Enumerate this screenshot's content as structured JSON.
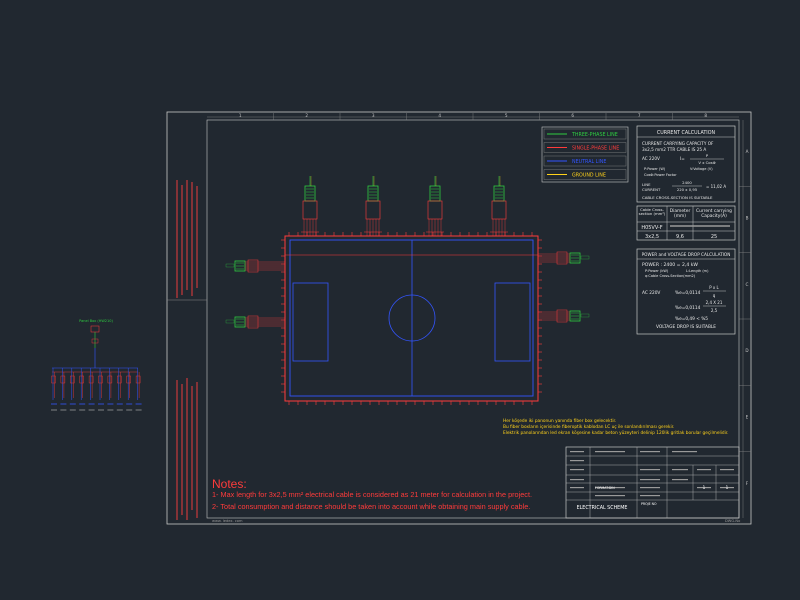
{
  "legend": {
    "items": [
      {
        "label": "THREE-PHASE LINE",
        "color": "#2ecc40"
      },
      {
        "label": "SINGLE-PHASE LINE",
        "color": "#ff3b3b"
      },
      {
        "label": "NEUTRAL LINE",
        "color": "#3355ff"
      },
      {
        "label": "GROUND LINE",
        "color": "#ffd21a"
      }
    ]
  },
  "column_numbers": [
    "1",
    "2",
    "3",
    "4",
    "5",
    "6",
    "7",
    "8"
  ],
  "row_letters": [
    "A",
    "B",
    "C",
    "D",
    "E",
    "F"
  ],
  "current_calc": {
    "title": "CURRENT CALCULATION",
    "line1": "CURRENT CARRYING CAPACITY OF",
    "line2": "3x2,5 mm2 TTR CABLE IS 25 A",
    "ac": "AC 220V",
    "i_eq": "I=",
    "frac_top": "P",
    "frac_bot": "V x CosΦ",
    "p_def": "P:Power (W)",
    "v_def": "V:Voltage (V)",
    "cos_def": "CosΦ:Power Factor",
    "line_current_a": "LINE",
    "line_current_b": "CURRENT",
    "lc_top": "2400",
    "lc_bot": "220 x 0,95",
    "lc_result": "= 11,02 A",
    "cable_ok": "CABLE CROSS-SECTION IS SUITABLE"
  },
  "cable_table": {
    "headers": [
      "Cable Cross-section (mm²)",
      "Diameter (mm)",
      "Current carrying Capacity(A)"
    ],
    "row1": [
      "H05VV-F",
      "",
      ""
    ],
    "row2": [
      "3x2,5",
      "9,6",
      "25"
    ]
  },
  "voltage_calc": {
    "title": "POWER and VOLTAGE DROP CALCULATION",
    "power": "POWER : 2400 = 2,4 kW",
    "p_def": "P:Power (kW)",
    "l_def": "L:Length (m)",
    "s_def": "q:Cable Cross-Section(mm2)",
    "ac": "AC 220V",
    "eq1": "%e=0,0114",
    "f1_top": "P x L",
    "f1_bot": "q",
    "eq2": "%e=0,0114",
    "f2_top": "2,4 X 21",
    "f2_bot": "2,5",
    "eq3": "%e=0,49 < %5",
    "ok": "VOLTAGE DROP IS SUITABLE"
  },
  "turkish_notes": [
    "Her köşede iki panonun yanında fiber box gelecektir.",
    "Bu fiber boxların içerisinde fiberoptik kablodan LC uç ile sonlandırılması gerekir.",
    "Elektrik panolarından led ekran köşesine kadar beton yüzeyteri delinip 120lik gritlak borular geçilmelidir."
  ],
  "notes": {
    "title": "Notes:",
    "line1": "1- Max length for 3x2,5 mm² electrical cable is considered as 21 meter for calculation in the project.",
    "line2": "2- Total consumption and distance should be taken into account while obtaining main supply cable."
  },
  "title_block": {
    "scheme": "ELECTRICAL SCHEME",
    "cell_a": "FORMAT:DIN",
    "cell_b": "PROJE NO",
    "cell_c": "1",
    "cell_d": "1"
  },
  "footer": {
    "left": "www. ledex. com",
    "right": "DWG-No"
  },
  "left_panel": {
    "feed_label": "Panel Box (HW210)"
  }
}
